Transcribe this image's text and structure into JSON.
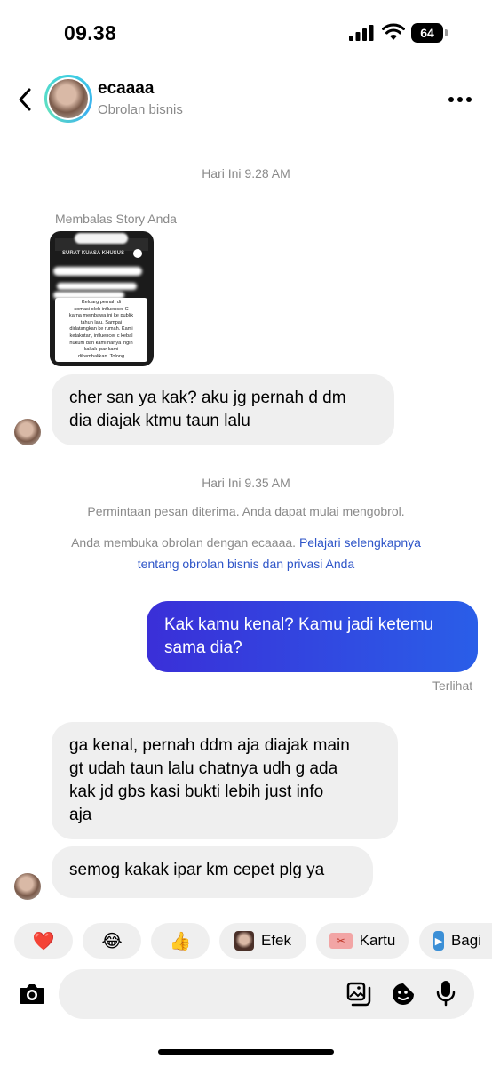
{
  "status_bar": {
    "time": "09.38",
    "battery": "64"
  },
  "header": {
    "name": "ecaaaa",
    "subtitle": "Obrolan bisnis"
  },
  "chat": {
    "ts1": "Hari Ini 9.28 AM",
    "reply_label": "Membalas Story Anda",
    "msg1": [
      "cher san ya kak? aku jg pernah d dm",
      "dia diajak ktmu taun lalu"
    ],
    "ts2": "Hari Ini 9.35 AM",
    "info1": "Permintaan pesan diterima. Anda dapat mulai mengobrol.",
    "info2_text": "Anda membuka obrolan dengan ecaaaa. ",
    "info2_link": "Pelajari selengkapnya tentang obrolan bisnis dan privasi Anda",
    "out1": [
      "Kak kamu kenal? Kamu jadi ketemu",
      "sama dia?"
    ],
    "seen": "Terlihat",
    "msg2": [
      "ga kenal, pernah ddm aja diajak main",
      "gt udah taun lalu chatnya udh g ada",
      "kak jd gbs kasi bukti lebih just info",
      "aja"
    ],
    "msg3": "semog kakak ipar km cepet plg ya"
  },
  "story_preview": {
    "header": "SURAT KUASA KHUSUS",
    "lines": [
      "Keluarg        pernah di",
      "somasi oleh influencer C",
      "karna membawa ini ke publik",
      "tahun lalu. Sampai",
      "didatangkan ke rumah. Kami",
      "ketakutan, influencer c kebal",
      "hukum dan kami hanya ingin",
      "kakak ipar kami",
      "dikembalikan. Tolong"
    ]
  },
  "quick_replies": [
    {
      "icon": "heart",
      "emoji": "❤️"
    },
    {
      "icon": "laughing",
      "emoji": "😂"
    },
    {
      "icon": "thumbs-up",
      "emoji": "👍"
    },
    {
      "icon": "effects-face",
      "label": "Efek"
    },
    {
      "icon": "card",
      "label": "Kartu"
    },
    {
      "icon": "play",
      "label": "Bagi"
    }
  ],
  "colors": {
    "outgoing_start": "#3a2fd8",
    "outgoing_end": "#2a5ee8",
    "incoming": "#efefef",
    "link": "#2e55c8"
  }
}
